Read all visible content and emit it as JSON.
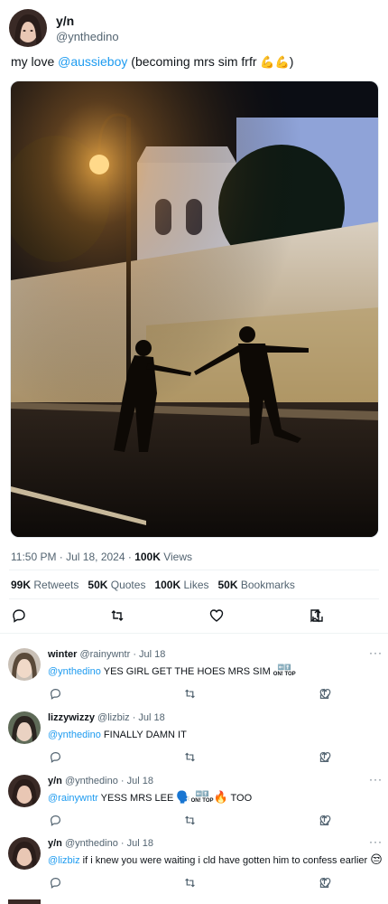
{
  "tweet": {
    "display_name": "y/n",
    "handle": "@ynthedino",
    "text_prefix": "my love ",
    "mention": "@aussieboy",
    "text_suffix": " (becoming mrs sim frfr ",
    "emoji": "💪💪",
    "text_end": ")",
    "time": "11:50 PM · Jul 18, 2024 · ",
    "views_count": "100K",
    "views_label": " Views"
  },
  "stats": [
    {
      "count": "99K",
      "label": "Retweets"
    },
    {
      "count": "50K",
      "label": "Quotes"
    },
    {
      "count": "100K",
      "label": "Likes"
    },
    {
      "count": "50K",
      "label": "Bookmarks"
    }
  ],
  "replies": [
    {
      "name": "winter",
      "meta": "@rainywntr · Jul 18",
      "mention": "@ynthedino",
      "text": " YES GIRL GET THE HOES MRS SIM ",
      "trail": ""
    },
    {
      "name": "lizzywizzy",
      "meta": "@lizbiz · Jul 18",
      "mention": "@ynthedino",
      "text": " FINALLY DAMN IT",
      "trail": ""
    },
    {
      "name": "y/n",
      "meta": "@ynthedino · Jul 18",
      "mention": "@rainywntr",
      "text": " YESS MRS LEE ",
      "trail": " TOO"
    },
    {
      "name": "y/n",
      "meta": "@ynthedino · Jul 18",
      "mention": "@lizbiz",
      "text": " if i knew you were waiting i cld have gotten him to confess earlier ",
      "trail": ""
    }
  ],
  "more_label": "···",
  "colors": {
    "accent": "#1d9bf0",
    "muted": "#536471",
    "text": "#0f1419"
  }
}
